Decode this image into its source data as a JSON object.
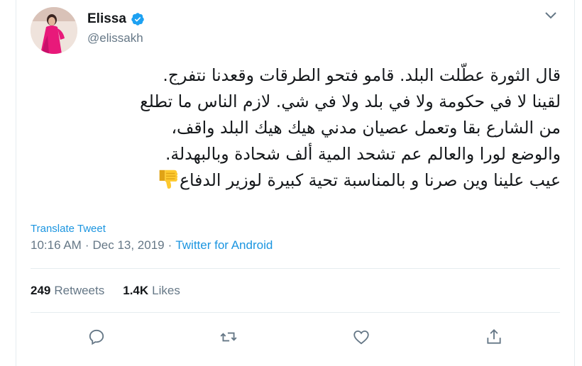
{
  "author": {
    "display_name": "Elissa",
    "handle": "@elissakh",
    "verified_icon": "verified-badge-icon",
    "avatar_desc": "profile-photo"
  },
  "tweet": {
    "lines": [
      "قال الثورة عطّلت البلد. قامو فتحو الطرقات وقعدنا نتفرج.",
      "لقينا لا في حكومة ولا في بلد ولا في شي. لازم الناس ما تطلع",
      "من الشارع بقا وتعمل عصيان مدني هيك هيك البلد واقف،",
      "والوضع لورا والعالم عم تشحد المية ألف شحادة وبالبهدلة.",
      "عيب علينا وين صرنا و بالمناسبة تحية كبيرة لوزير الدفاع"
    ],
    "emoji": "thumbs-down-emoji"
  },
  "translate_label": "Translate Tweet",
  "meta": {
    "time": "10:16 AM",
    "separator1": "·",
    "date": "Dec 13, 2019",
    "separator2": "·",
    "source": "Twitter for Android"
  },
  "stats": {
    "retweets_count": "249",
    "retweets_label": "Retweets",
    "likes_count": "1.4K",
    "likes_label": "Likes"
  },
  "actions": [
    "reply-icon",
    "retweet-icon",
    "like-icon",
    "share-icon"
  ],
  "colors": {
    "link": "#1b95e0",
    "secondary_text": "#657786",
    "divider": "#e6ecf0",
    "verified": "#1da1f2"
  }
}
